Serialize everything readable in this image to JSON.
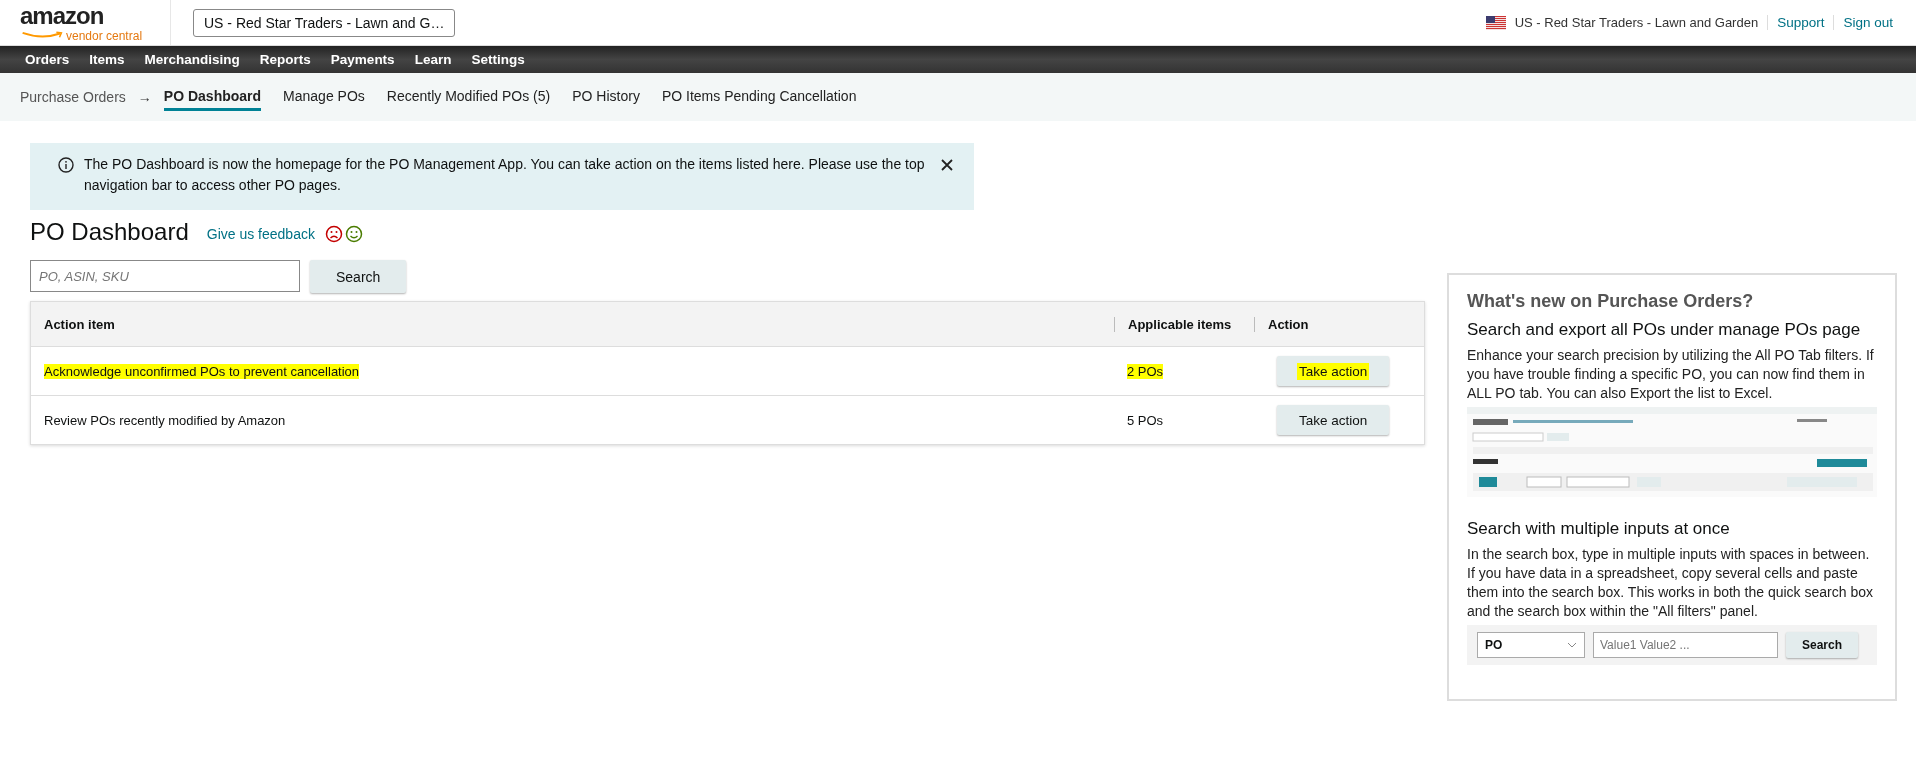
{
  "header": {
    "logo": {
      "wordmark": "amazon",
      "product": "vendor central"
    },
    "account_selector": "US - Red Star Traders - Lawn and G…",
    "account": "US - Red Star Traders - Lawn and Garden",
    "links": [
      "Support",
      "Sign out"
    ]
  },
  "main_nav": [
    "Orders",
    "Items",
    "Merchandising",
    "Reports",
    "Payments",
    "Learn",
    "Settings"
  ],
  "sub_nav": {
    "parent": "Purchase Orders",
    "arrow": "→",
    "tabs": [
      {
        "label": "PO Dashboard",
        "selected": true
      },
      {
        "label": "Manage POs",
        "selected": false
      },
      {
        "label": "Recently Modified POs (5)",
        "selected": false
      },
      {
        "label": "PO History",
        "selected": false
      },
      {
        "label": "PO Items Pending Cancellation",
        "selected": false
      }
    ]
  },
  "banner": {
    "text": "The PO Dashboard is now the homepage for the PO Management App. You can take action on the items listed here. Please use the top navigation bar to access other PO pages."
  },
  "page_title": "PO Dashboard",
  "feedback_link": "Give us feedback",
  "search": {
    "placeholder": "PO, ASIN, SKU",
    "button": "Search"
  },
  "table": {
    "columns": [
      "Action item",
      "Applicable items",
      "Action"
    ],
    "rows": [
      {
        "action_item": "Acknowledge unconfirmed POs to prevent cancellation",
        "applicable_items": "2 POs",
        "button": "Take action",
        "highlighted": true
      },
      {
        "action_item": "Review POs recently modified by Amazon",
        "applicable_items": "5 POs",
        "button": "Take action",
        "highlighted": false
      }
    ]
  },
  "whats_new": {
    "title": "What's new on Purchase Orders?",
    "sections": [
      {
        "heading": "Search and export all POs under manage POs page",
        "body": "Enhance your search precision by utilizing the All PO Tab filters. If you have trouble finding a specific PO, you can now find them in ALL PO tab. You can also Export the list to Excel."
      },
      {
        "heading": "Search with multiple inputs at once",
        "body": "In the search box, type in multiple inputs with spaces in between. If you have data in a spreadsheet, copy several cells and paste them into the search box. This works in both the quick search box and the search box within the \"All filters\" panel.",
        "illustration": {
          "kind": "search_demo",
          "select": "PO",
          "placeholder": "Value1 Value2 ...",
          "button": "Search"
        }
      }
    ]
  }
}
